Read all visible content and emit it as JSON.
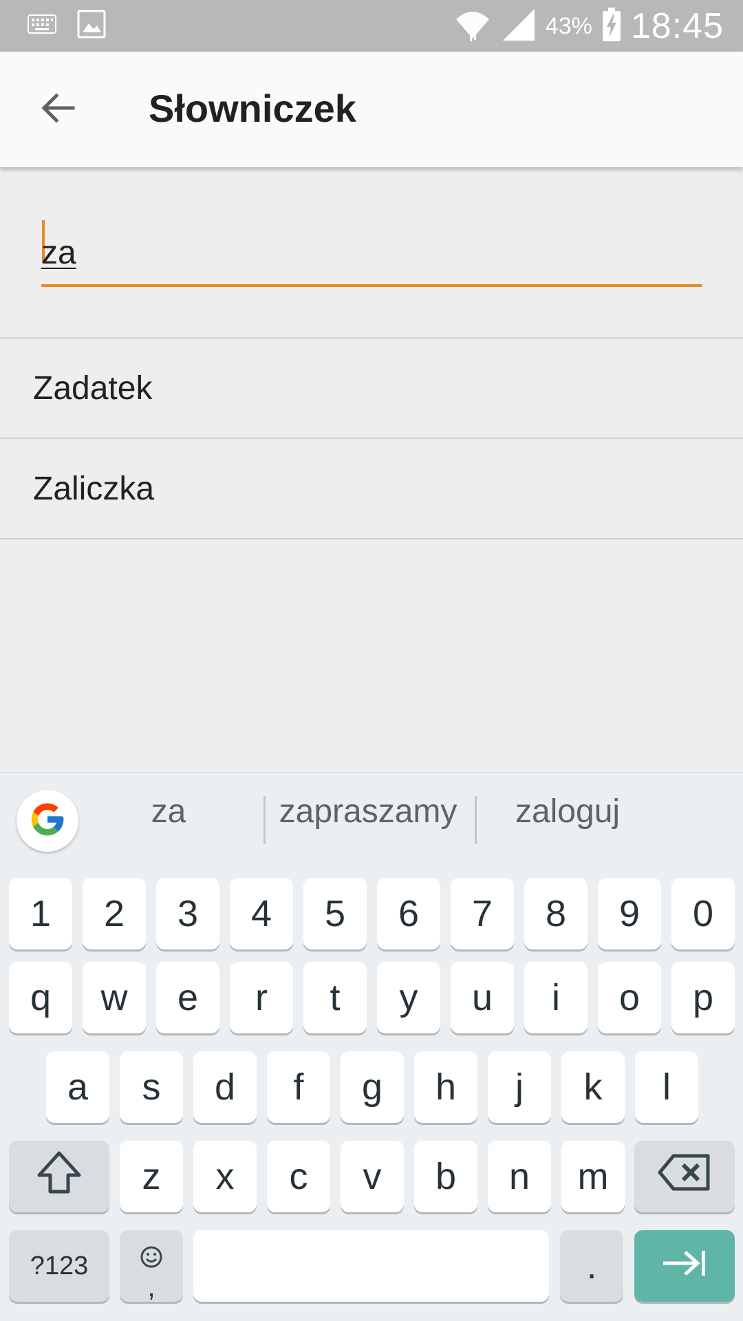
{
  "status_bar": {
    "battery_percent": "43%",
    "time": "18:45",
    "icons": [
      "keyboard-icon",
      "image-icon",
      "wifi-icon",
      "signal-icon",
      "battery-charging-icon"
    ]
  },
  "app_bar": {
    "title": "Słowniczek",
    "back_icon": "arrow-back-icon"
  },
  "search": {
    "value": "za",
    "accent_color": "#e8892a"
  },
  "results": [
    {
      "label": "Zadatek"
    },
    {
      "label": "Zaliczka"
    }
  ],
  "keyboard": {
    "suggestions": [
      "za",
      "zapraszamy",
      "zaloguj"
    ],
    "number_row": [
      "1",
      "2",
      "3",
      "4",
      "5",
      "6",
      "7",
      "8",
      "9",
      "0"
    ],
    "row1": [
      "q",
      "w",
      "e",
      "r",
      "t",
      "y",
      "u",
      "i",
      "o",
      "p"
    ],
    "row2": [
      "a",
      "s",
      "d",
      "f",
      "g",
      "h",
      "j",
      "k",
      "l"
    ],
    "row3": [
      "z",
      "x",
      "c",
      "v",
      "b",
      "n",
      "m"
    ],
    "symbols_label": "?123",
    "comma_label": ",",
    "period_label": ".",
    "enter_color": "#5fb6a6"
  }
}
